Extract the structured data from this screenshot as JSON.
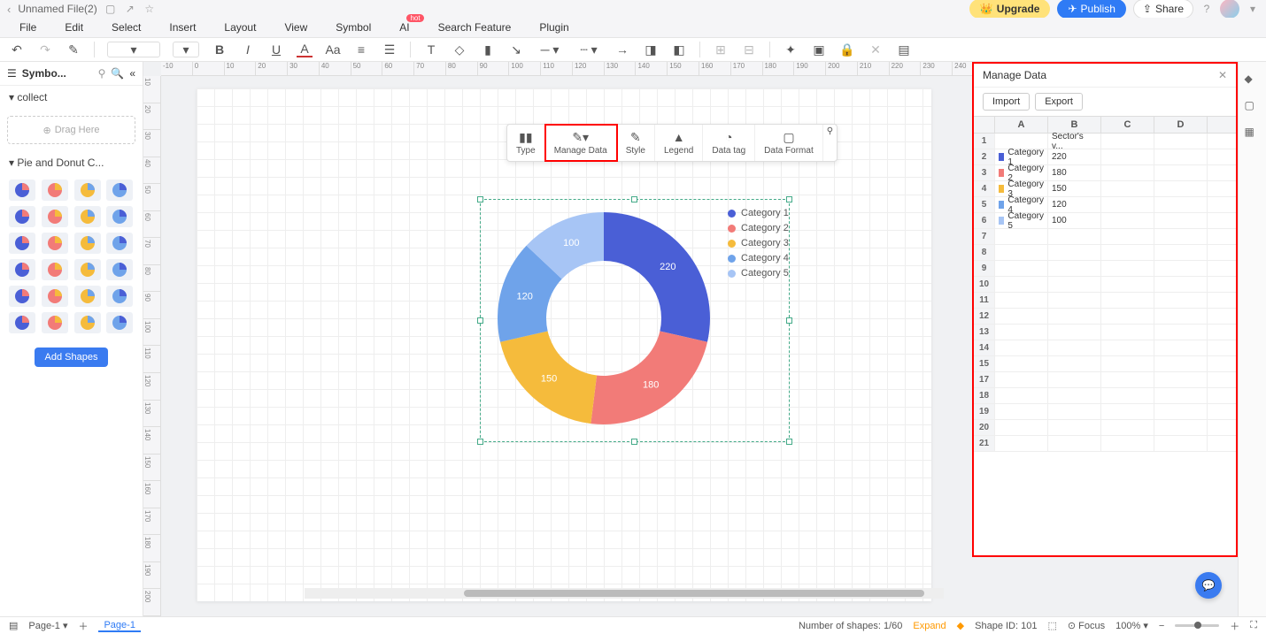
{
  "file": {
    "name": "Unnamed File(2)"
  },
  "top_buttons": {
    "upgrade": "Upgrade",
    "publish": "Publish",
    "share": "Share"
  },
  "menu": [
    "File",
    "Edit",
    "Select",
    "Insert",
    "Layout",
    "View",
    "Symbol",
    "AI",
    "Search Feature",
    "Plugin"
  ],
  "hot_badge": "hot",
  "sidebar": {
    "title": "Symbo...",
    "collect": "collect",
    "drag_here": "Drag Here",
    "category": "Pie and Donut C...",
    "add_shapes": "Add Shapes"
  },
  "float_toolbar": {
    "type": "Type",
    "manage_data": "Manage Data",
    "style": "Style",
    "legend": "Legend",
    "data_tag": "Data tag",
    "data_format": "Data Format"
  },
  "chart_data": {
    "type": "donut",
    "title": "Sector's v...",
    "series": [
      {
        "name": "Category 1",
        "value": 220,
        "color": "#4a5fd6"
      },
      {
        "name": "Category 2",
        "value": 180,
        "color": "#f27b78"
      },
      {
        "name": "Category 3",
        "value": 150,
        "color": "#f5bb3c"
      },
      {
        "name": "Category 4",
        "value": 120,
        "color": "#6fa3ea"
      },
      {
        "name": "Category 5",
        "value": 100,
        "color": "#a7c5f5"
      }
    ]
  },
  "data_panel": {
    "title": "Manage Data",
    "import": "Import",
    "export": "Export",
    "cols": [
      "A",
      "B",
      "C",
      "D"
    ],
    "header_row": "Sector's v...",
    "empty_rows": [
      7,
      8,
      9,
      10,
      11,
      12,
      13,
      14,
      15,
      17,
      18,
      19,
      20,
      21
    ]
  },
  "status": {
    "page_name": "Page-1",
    "page_tab": "Page-1",
    "shapes_count": "Number of shapes: 1/60",
    "expand": "Expand",
    "shape_id": "Shape ID: 101",
    "focus": "Focus",
    "zoom": "100%"
  }
}
